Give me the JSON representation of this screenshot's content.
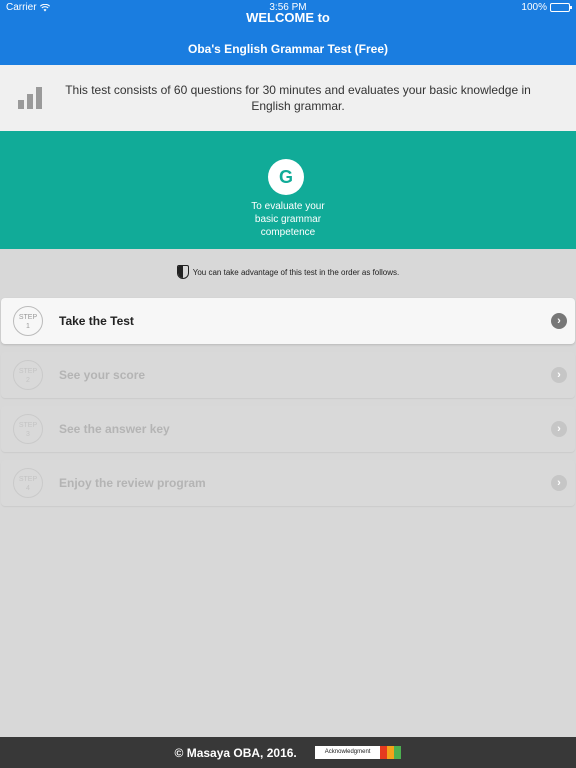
{
  "status_bar": {
    "carrier": "Carrier",
    "time": "3:56 PM",
    "battery": "100%"
  },
  "header": {
    "title_line1": "WELCOME to",
    "title_line2": "Oba's English Grammar Test (Free)"
  },
  "intro": {
    "icon": "bar-chart-icon",
    "text": "This test consists of 60 questions for 30 minutes and evaluates your basic knowledge in English grammar."
  },
  "banner": {
    "badge_letter": "G",
    "line1": "To evaluate your",
    "line2": "basic grammar",
    "line3": "competence",
    "color": "#11ab98"
  },
  "hint": {
    "icon": "beginner-leaf-icon",
    "text": "You can take advantage of this test in the order as follows."
  },
  "steps": [
    {
      "step_word": "STEP",
      "number": "1",
      "label": "Take the Test",
      "enabled": true
    },
    {
      "step_word": "STEP",
      "number": "2",
      "label": "See your score",
      "enabled": false
    },
    {
      "step_word": "STEP",
      "number": "3",
      "label": "See the answer key",
      "enabled": false
    },
    {
      "step_word": "STEP",
      "number": "4",
      "label": "Enjoy the review program",
      "enabled": false
    }
  ],
  "footer": {
    "copyright": "© Masaya OBA, 2016.",
    "acknowledgment_label": "Acknowledgment",
    "stripe_colors": [
      "#e53a1f",
      "#f3a21a",
      "#4caf50"
    ]
  },
  "colors": {
    "header_blue": "#1a7de0",
    "teal": "#11ab98",
    "footer_dark": "#383838"
  }
}
